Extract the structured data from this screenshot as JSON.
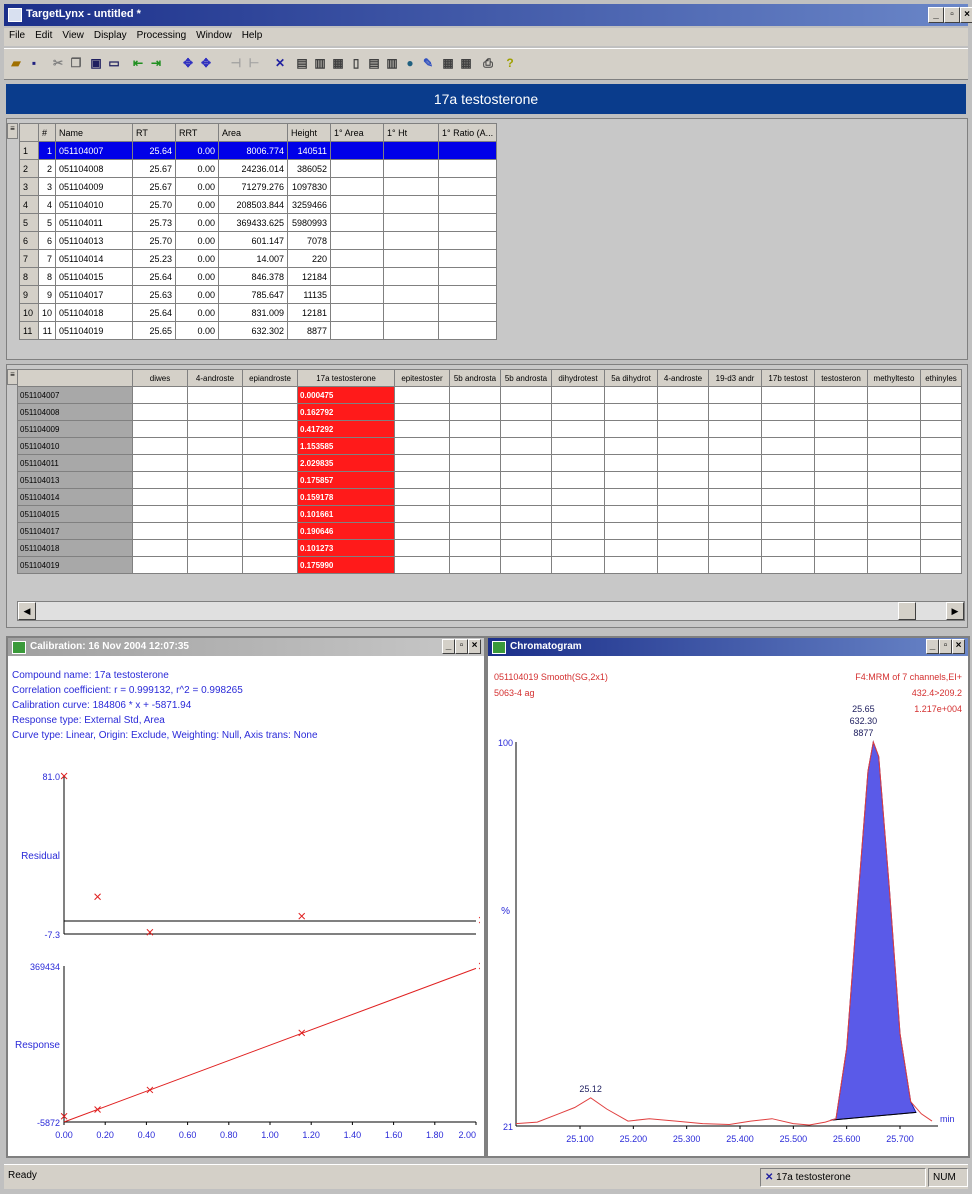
{
  "window": {
    "title": "TargetLynx - untitled *",
    "min": "_",
    "max": "▫",
    "close": "×"
  },
  "menu": [
    "File",
    "Edit",
    "View",
    "Display",
    "Processing",
    "Window",
    "Help"
  ],
  "header": {
    "compound": "17a testosterone"
  },
  "sample_table": {
    "columns": [
      "#",
      "Name",
      "RT",
      "RRT",
      "Area",
      "Height",
      "1° Area",
      "1° Ht",
      "1° Ratio (A..."
    ],
    "rows": [
      [
        "1",
        "051104007",
        "25.64",
        "0.00",
        "8006.774",
        "140511",
        "",
        "",
        ""
      ],
      [
        "2",
        "051104008",
        "25.67",
        "0.00",
        "24236.014",
        "386052",
        "",
        "",
        ""
      ],
      [
        "3",
        "051104009",
        "25.67",
        "0.00",
        "71279.276",
        "1097830",
        "",
        "",
        ""
      ],
      [
        "4",
        "051104010",
        "25.70",
        "0.00",
        "208503.844",
        "3259466",
        "",
        "",
        ""
      ],
      [
        "5",
        "051104011",
        "25.73",
        "0.00",
        "369433.625",
        "5980993",
        "",
        "",
        ""
      ],
      [
        "6",
        "051104013",
        "25.70",
        "0.00",
        "601.147",
        "7078",
        "",
        "",
        ""
      ],
      [
        "7",
        "051104014",
        "25.23",
        "0.00",
        "14.007",
        "220",
        "",
        "",
        ""
      ],
      [
        "8",
        "051104015",
        "25.64",
        "0.00",
        "846.378",
        "12184",
        "",
        "",
        ""
      ],
      [
        "9",
        "051104017",
        "25.63",
        "0.00",
        "785.647",
        "11135",
        "",
        "",
        ""
      ],
      [
        "10",
        "051104018",
        "25.64",
        "0.00",
        "831.009",
        "12181",
        "",
        "",
        ""
      ],
      [
        "11",
        "051104019",
        "25.65",
        "0.00",
        "632.302",
        "8877",
        "",
        "",
        ""
      ]
    ],
    "selected_row": 0
  },
  "matrix_table": {
    "columns": [
      "",
      "diwes",
      "4-androste",
      "epiandroste",
      "17a testosterone",
      "epitestoster",
      "5b androsta",
      "5b androsta",
      "dihydrotest",
      "5a dihydrot",
      "4-androste",
      "19-d3 andr",
      "17b testost",
      "testosteron",
      "methyltesto",
      "ethinyles"
    ],
    "rows": [
      "051104007",
      "051104008",
      "051104009",
      "051104010",
      "051104011",
      "051104013",
      "051104014",
      "051104015",
      "051104017",
      "051104018",
      "051104019"
    ],
    "highlight_col": 4,
    "highlight_values": [
      "0.000475",
      "0.162792",
      "0.417292",
      "1.153585",
      "2.029835",
      "0.175857",
      "0.159178",
      "0.101661",
      "0.190646",
      "0.101273",
      "0.175990"
    ]
  },
  "calibration": {
    "window_title": "Calibration: 16 Nov 2004 12:07:35",
    "info": [
      "Compound name: 17a testosterone",
      "Correlation coefficient: r = 0.999132, r^2 = 0.998265",
      "Calibration curve: 184806 * x + -5871.94",
      "Response type: External Std, Area",
      "Curve type: Linear, Origin: Exclude, Weighting: Null, Axis trans: None"
    ]
  },
  "chart_data": [
    {
      "type": "scatter",
      "title": "",
      "ylabel": "Residual",
      "xlabel": "",
      "ylim": [
        -7.3,
        81.0
      ],
      "xlim": [
        0,
        2.0
      ],
      "y_tick_labels": [
        "81.0",
        "-7.3"
      ],
      "x": [
        0.000475,
        0.163,
        0.417,
        1.154,
        2.03
      ],
      "values": [
        81.0,
        13.5,
        -6.3,
        2.7,
        0.5
      ],
      "baseline": 0
    },
    {
      "type": "line",
      "title": "",
      "ylabel": "Response",
      "xlabel": "",
      "ylim": [
        -5872,
        369434
      ],
      "xlim": [
        0,
        2.0
      ],
      "y_tick_labels": [
        "369434",
        "-5872"
      ],
      "x_ticks": [
        "0.00",
        "0.20",
        "0.40",
        "0.60",
        "0.80",
        "1.00",
        "1.20",
        "1.40",
        "1.60",
        "1.80",
        "2.00"
      ],
      "points": {
        "x": [
          0.000475,
          0.163,
          0.417,
          1.154,
          2.03
        ],
        "y": [
          8007,
          24236,
          71279,
          208504,
          369434
        ]
      },
      "fit": {
        "slope": 184806,
        "intercept": -5871.94
      },
      "color": "#e02020"
    },
    {
      "type": "line",
      "title": "",
      "ylabel": "%",
      "xlabel": "min",
      "xlim": [
        24.98,
        25.76
      ],
      "ylim": [
        21,
        100
      ],
      "y_tick_labels": [
        "100",
        "21"
      ],
      "x_ticks": [
        "25.100",
        "25.200",
        "25.300",
        "25.400",
        "25.500",
        "25.600",
        "25.700"
      ],
      "x": [
        24.98,
        25.02,
        25.06,
        25.09,
        25.12,
        25.15,
        25.19,
        25.23,
        25.28,
        25.33,
        25.38,
        25.42,
        25.46,
        25.5,
        25.53,
        25.56,
        25.58,
        25.6,
        25.62,
        25.64,
        25.65,
        25.66,
        25.68,
        25.7,
        25.72,
        25.74,
        25.76
      ],
      "y": [
        21.5,
        21.8,
        23.5,
        24.8,
        26.8,
        24.5,
        22.0,
        22.5,
        22.0,
        21.5,
        21.3,
        22.0,
        22.5,
        21.5,
        21.2,
        21.8,
        22.5,
        37.0,
        66.0,
        94.0,
        100.0,
        97.0,
        70.0,
        40.0,
        26.0,
        23.5,
        22.0
      ],
      "peak_labels": [
        {
          "rt": "25.12",
          "x": 25.12
        },
        {
          "rt": "25.65",
          "area": "632.30",
          "height": "8877",
          "x": 25.65
        }
      ],
      "integrated_region": [
        25.57,
        25.73
      ],
      "fill_color": "#5a5ae8",
      "line_color": "#e04040"
    }
  ],
  "chromatogram": {
    "window_title": "Chromatogram",
    "sample": "051104019  Smooth(SG,2x1)",
    "sub": "5063-4 ag",
    "channel": "F4:MRM of 7 channels,EI+",
    "transition": "432.4>209.2",
    "intensity": "1.217e+004"
  },
  "status": {
    "left": "Ready",
    "compound": "17a testosterone",
    "num": "NUM"
  }
}
